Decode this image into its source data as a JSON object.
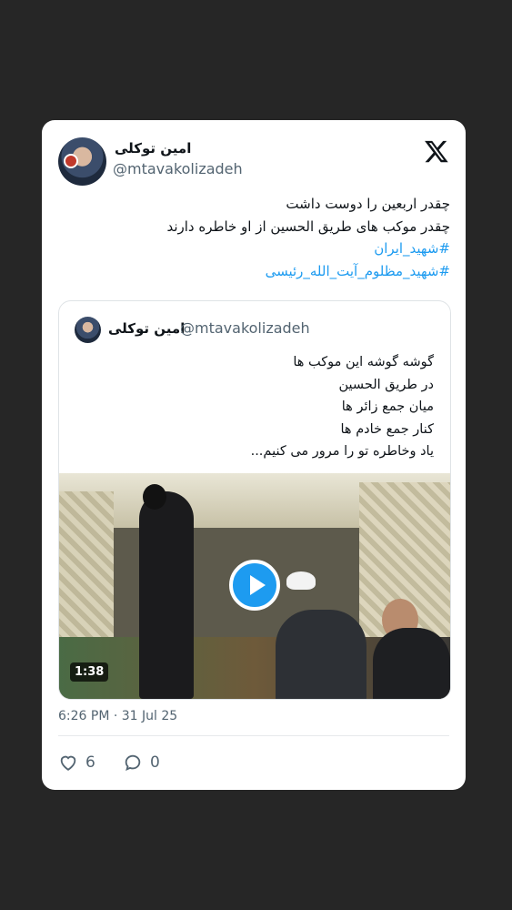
{
  "tweet": {
    "author_name": "امین توکلی",
    "handle": "@mtavakolizadeh",
    "text_lines": [
      "چقدر اربعین را دوست داشت",
      "چقدر موکب های طریق الحسین از او خاطره دارند"
    ],
    "hashtags": [
      "#شهید_ایران",
      "#شهید_مظلوم_آیت_الله_رئیسی"
    ],
    "timestamp": "6:26 PM · 31 Jul 25",
    "likes": "6",
    "replies": "0"
  },
  "quote": {
    "author_name": "امین توکلی",
    "handle": "@mtavakolizadeh",
    "text_lines": [
      "گوشه گوشه این موکب ها",
      "در طریق الحسین",
      "میان جمع زائر ها",
      "کنار جمع خادم ها",
      "یاد وخاطره تو را مرور می کنیم..."
    ],
    "video_duration": "1:38"
  },
  "icons": {
    "logo": "x-logo-icon",
    "like": "heart-icon",
    "reply": "comment-icon",
    "play": "play-icon"
  },
  "colors": {
    "background": "#262626",
    "card": "#ffffff",
    "accent": "#1d9bf0",
    "secondary_text": "#536471"
  }
}
